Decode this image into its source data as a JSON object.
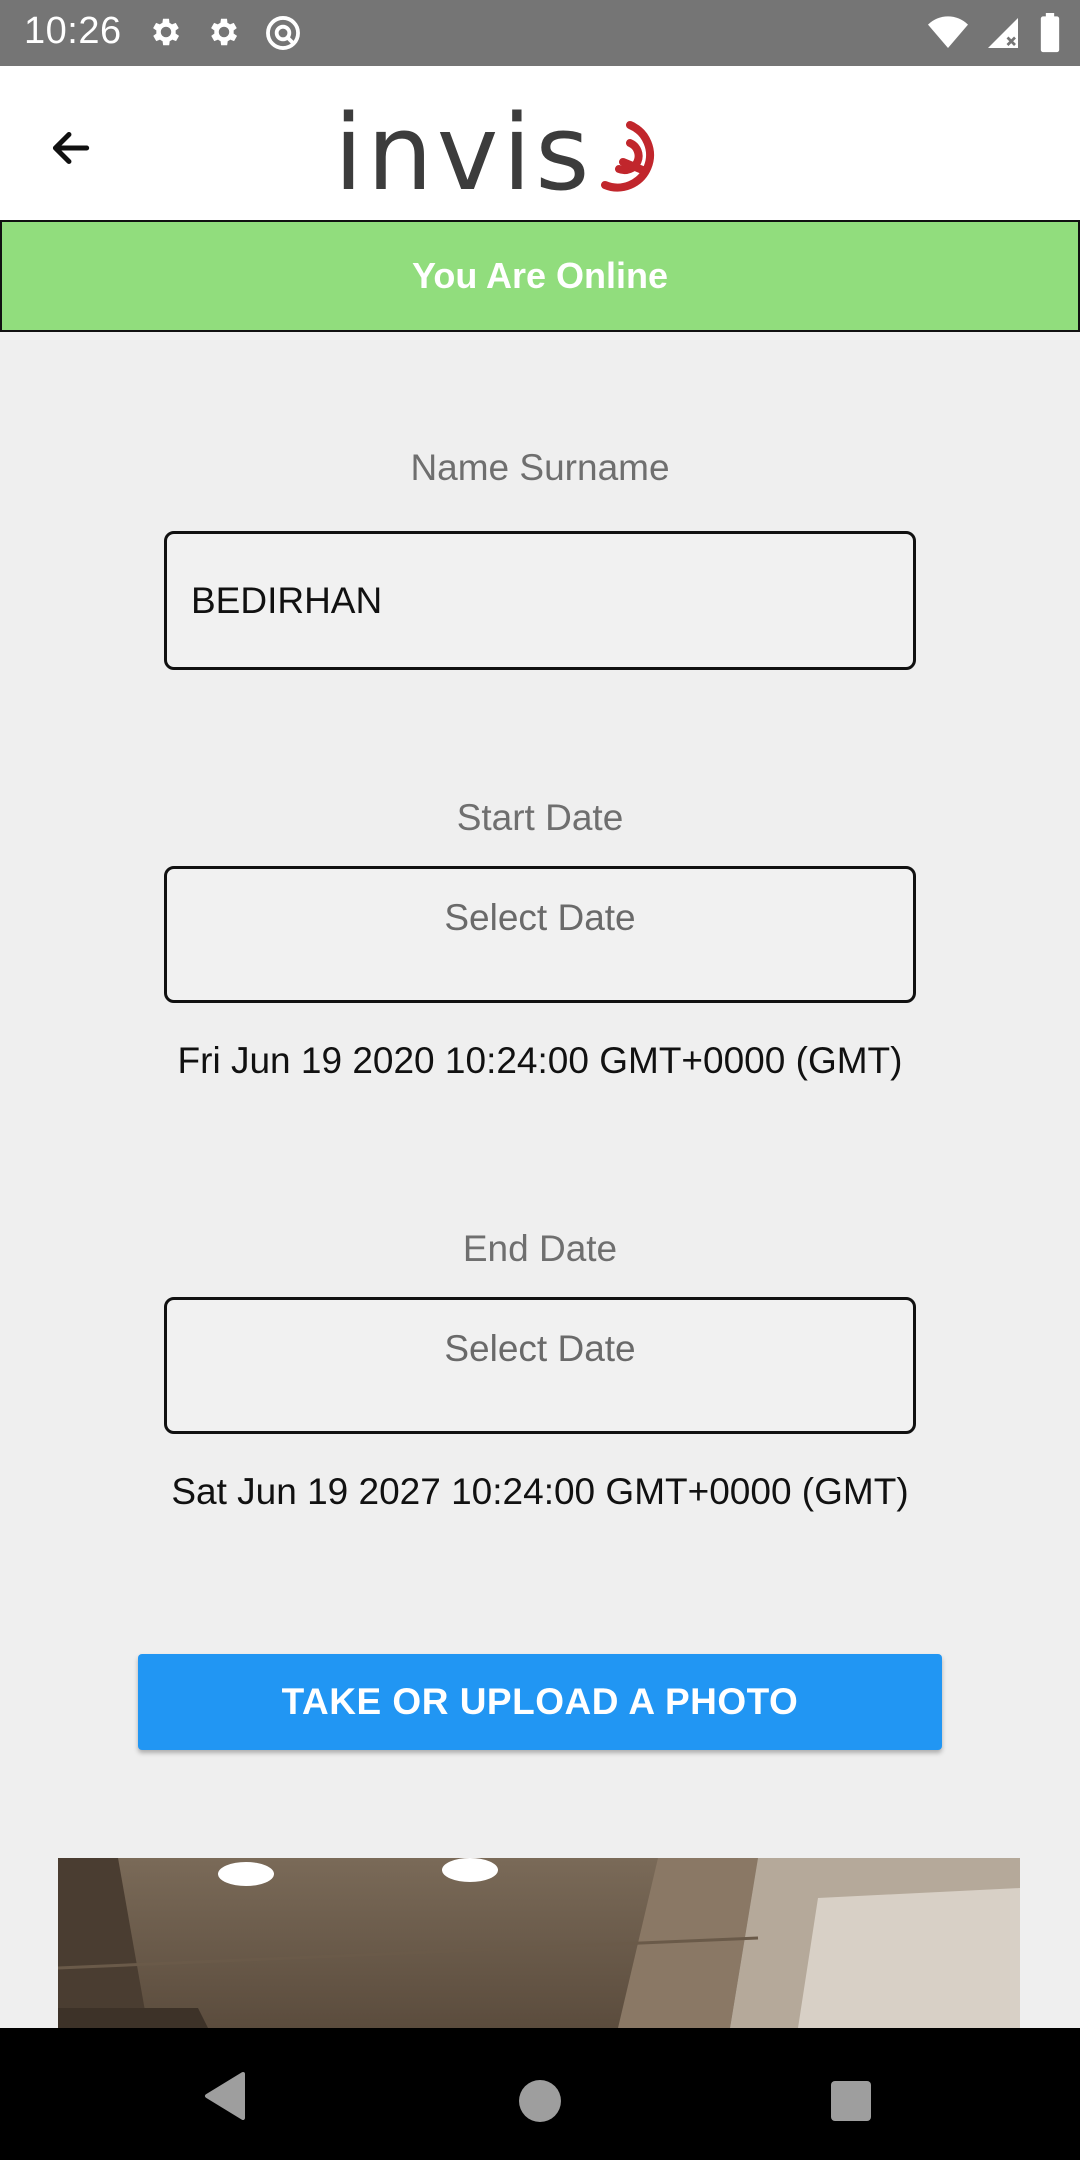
{
  "status_bar": {
    "time": "10:26",
    "left_icons": [
      "gear-icon",
      "gear-icon",
      "at-sign-icon"
    ],
    "right_icons": [
      "wifi-icon",
      "cell-signal-icon",
      "battery-icon"
    ]
  },
  "app_bar": {
    "back_icon": "arrow-back-icon",
    "logo_text": "invis"
  },
  "banner": {
    "text": "You Are Online",
    "color": "#91dd7d"
  },
  "form": {
    "name_label": "Name Surname",
    "name_value": "BEDIRHAN",
    "start_label": "Start Date",
    "start_placeholder": "Select Date",
    "start_value": "Fri Jun 19 2020 10:24:00 GMT+0000 (GMT)",
    "end_label": "End Date",
    "end_placeholder": "Select Date",
    "end_value": "Sat Jun 19 2027 10:24:00 GMT+0000 (GMT)"
  },
  "photo_button": {
    "label": "TAKE OR UPLOAD A PHOTO",
    "color": "#2196f3"
  },
  "nav_bar": {
    "icons": [
      "nav-back-icon",
      "nav-home-icon",
      "nav-recents-icon"
    ]
  }
}
